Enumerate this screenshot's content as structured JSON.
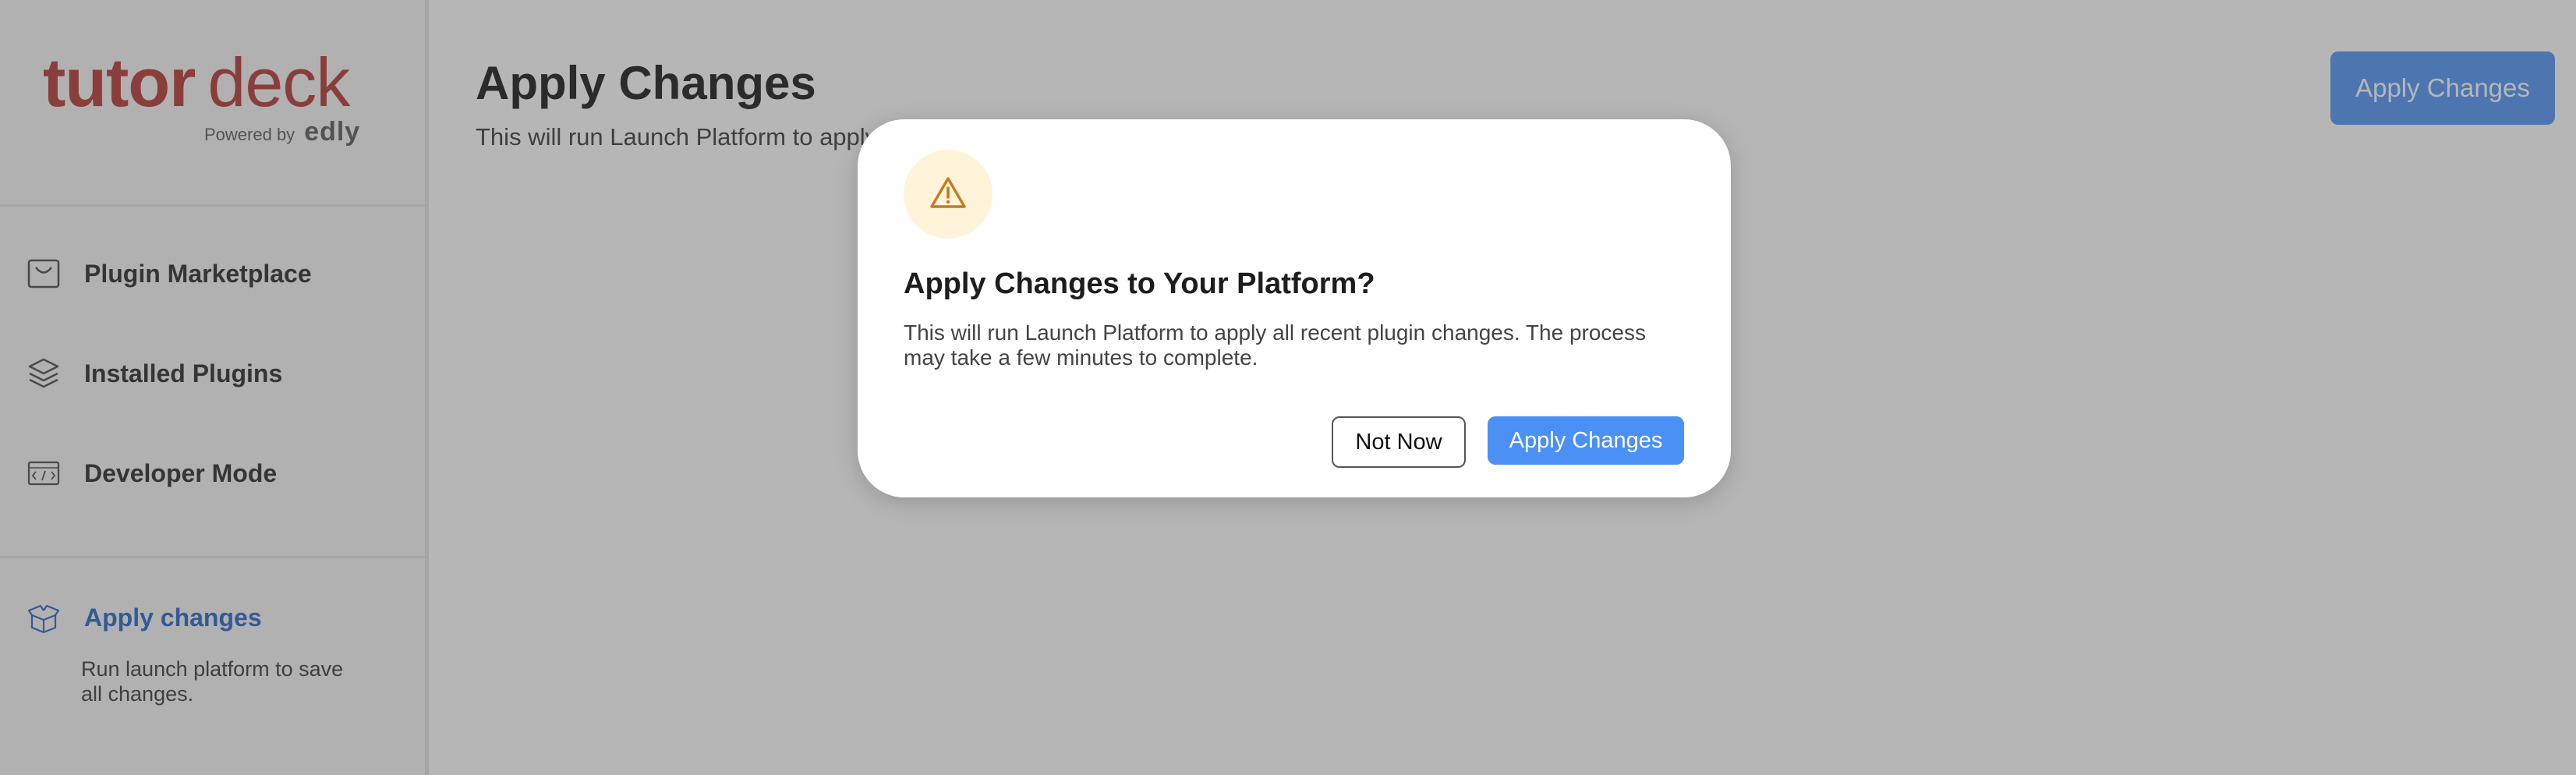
{
  "brand": {
    "name_part1": "tutor",
    "name_part2": "deck",
    "powered_by": "Powered by",
    "powered_brand": "edly",
    "color": "#b3312c"
  },
  "sidebar": {
    "items": [
      {
        "label": "Plugin Marketplace",
        "icon": "shopping-bag-icon"
      },
      {
        "label": "Installed Plugins",
        "icon": "layers-icon"
      },
      {
        "label": "Developer Mode",
        "icon": "code-window-icon"
      }
    ],
    "apply": {
      "label": "Apply changes",
      "description": "Run launch platform to save all changes.",
      "icon": "open-box-icon",
      "color": "#1f5fc8"
    }
  },
  "main": {
    "title": "Apply Changes",
    "subtitle": "This will run Launch Platform to apply all recent plugin changes.",
    "apply_button": "Apply Changes"
  },
  "modal": {
    "icon": "warning-triangle-icon",
    "title": "Apply Changes to Your Platform?",
    "message": "This will run Launch Platform to apply all recent plugin changes. The process may take a few minutes to complete.",
    "cancel_label": "Not Now",
    "confirm_label": "Apply Changes"
  },
  "colors": {
    "accent": "#4a90f5",
    "warning": "#c77a1a",
    "warning_bg": "#fff3d9",
    "overlay": "rgba(80,80,80,0.42)"
  }
}
